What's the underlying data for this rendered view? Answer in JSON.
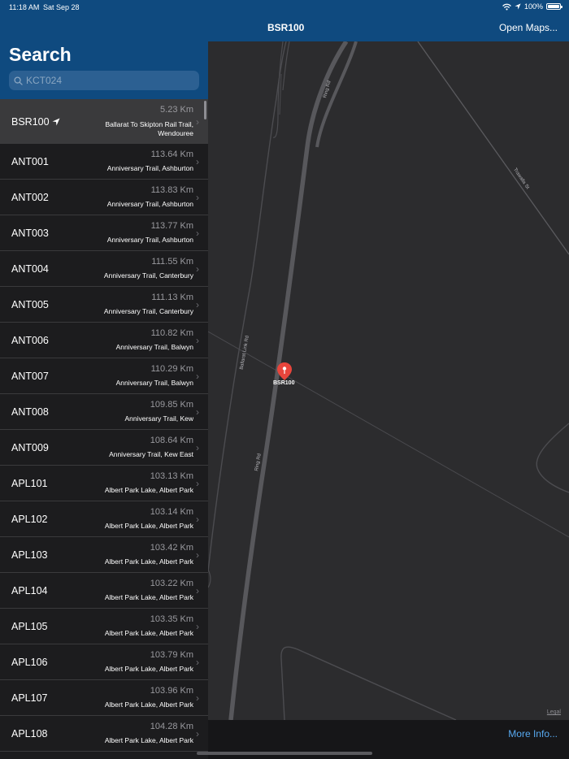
{
  "status_bar": {
    "time": "11:18 AM",
    "date": "Sat Sep 28",
    "battery": "100%",
    "battery_level": 1.0
  },
  "sidebar": {
    "title": "Search",
    "search": {
      "placeholder": "KCT024",
      "value": ""
    },
    "items": [
      {
        "code": "BSR100",
        "distance": "5.23 Km",
        "description": "Ballarat To Skipton Rail Trail, Wendouree",
        "selected": true,
        "current_location": true
      },
      {
        "code": "ANT001",
        "distance": "113.64 Km",
        "description": "Anniversary Trail, Ashburton"
      },
      {
        "code": "ANT002",
        "distance": "113.83 Km",
        "description": "Anniversary Trail, Ashburton"
      },
      {
        "code": "ANT003",
        "distance": "113.77 Km",
        "description": "Anniversary Trail, Ashburton"
      },
      {
        "code": "ANT004",
        "distance": "111.55 Km",
        "description": "Anniversary Trail, Canterbury"
      },
      {
        "code": "ANT005",
        "distance": "111.13 Km",
        "description": "Anniversary Trail, Canterbury"
      },
      {
        "code": "ANT006",
        "distance": "110.82 Km",
        "description": "Anniversary Trail, Balwyn"
      },
      {
        "code": "ANT007",
        "distance": "110.29 Km",
        "description": "Anniversary Trail, Balwyn"
      },
      {
        "code": "ANT008",
        "distance": "109.85 Km",
        "description": "Anniversary Trail, Kew"
      },
      {
        "code": "ANT009",
        "distance": "108.64 Km",
        "description": "Anniversary Trail, Kew East"
      },
      {
        "code": "APL101",
        "distance": "103.13 Km",
        "description": "Albert Park Lake, Albert Park"
      },
      {
        "code": "APL102",
        "distance": "103.14 Km",
        "description": "Albert Park Lake, Albert Park"
      },
      {
        "code": "APL103",
        "distance": "103.42 Km",
        "description": "Albert Park Lake, Albert Park"
      },
      {
        "code": "APL104",
        "distance": "103.22 Km",
        "description": "Albert Park Lake, Albert Park"
      },
      {
        "code": "APL105",
        "distance": "103.35 Km",
        "description": "Albert Park Lake, Albert Park"
      },
      {
        "code": "APL106",
        "distance": "103.79 Km",
        "description": "Albert Park Lake, Albert Park"
      },
      {
        "code": "APL107",
        "distance": "103.96 Km",
        "description": "Albert Park Lake, Albert Park"
      },
      {
        "code": "APL108",
        "distance": "104.28 Km",
        "description": "Albert Park Lake, Albert Park"
      }
    ]
  },
  "map_header": {
    "title": "BSR100",
    "open_maps": "Open Maps..."
  },
  "map": {
    "pin_label": "BSR100",
    "road_labels": {
      "ring_rd_top": "Ring Rd",
      "trawalla_st": "Trawalla St",
      "ballarat_link_rd": "Ballarat Link Rd",
      "ring_rd_bottom": "Ring Rd"
    },
    "legal": "Legal",
    "pin_color": "#e8453c"
  },
  "bottom_bar": {
    "more_info": "More Info..."
  },
  "colors": {
    "header_blue": "#0f4a7f",
    "accent_link": "#57a9f0"
  }
}
